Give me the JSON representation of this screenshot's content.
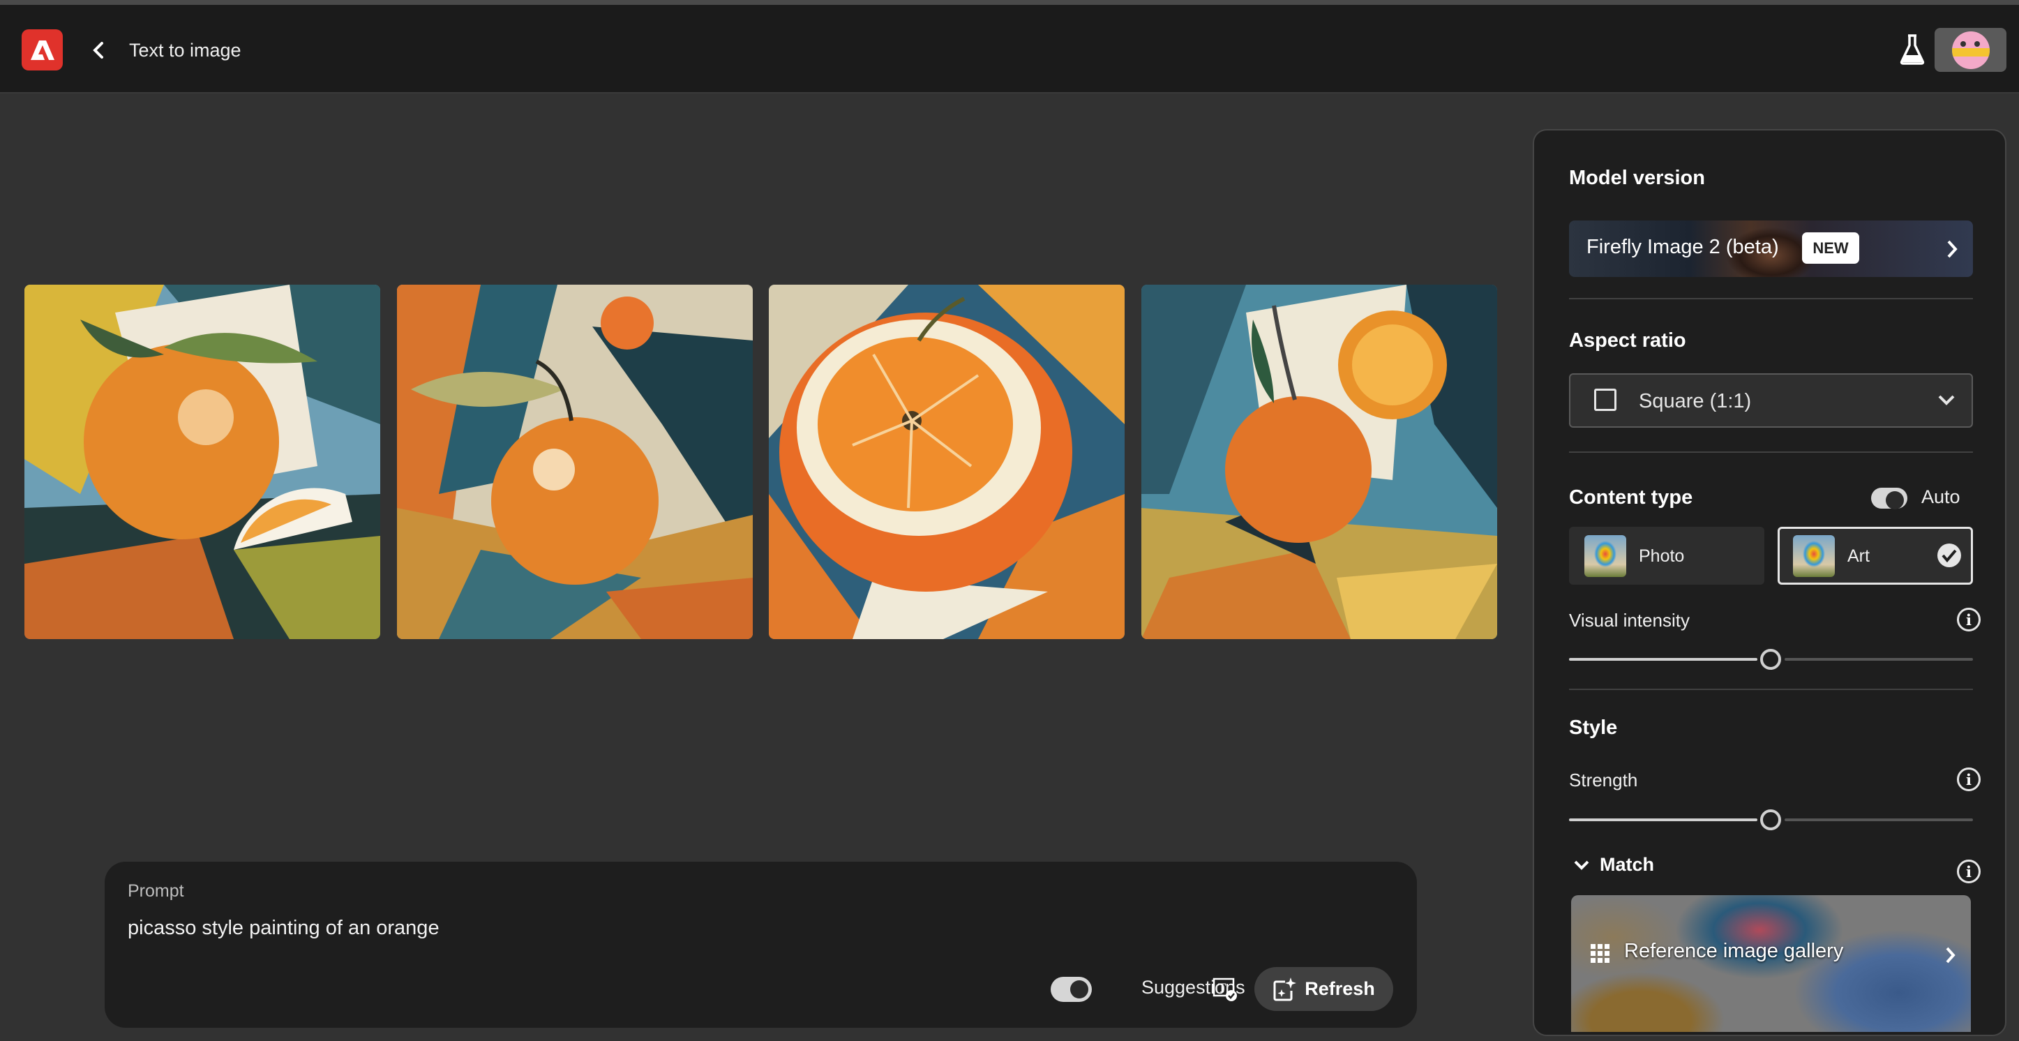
{
  "header": {
    "title": "Text to image",
    "logo": "adobe-logo",
    "back_icon": "chevron-left-icon",
    "labs_icon": "flask-icon",
    "avatar": "user-avatar"
  },
  "images": [
    {
      "alt": "orange-painting-1"
    },
    {
      "alt": "orange-painting-2"
    },
    {
      "alt": "orange-painting-3"
    },
    {
      "alt": "orange-painting-4"
    }
  ],
  "prompt": {
    "label": "Prompt",
    "value": "picasso style painting of an orange",
    "suggestions_label": "Suggestions",
    "suggestions_on": true,
    "refresh_label": "Refresh"
  },
  "panel": {
    "model_version": {
      "heading": "Model version",
      "value": "Firefly Image 2 (beta)",
      "badge": "NEW"
    },
    "aspect_ratio": {
      "heading": "Aspect ratio",
      "value": "Square (1:1)"
    },
    "content_type": {
      "heading": "Content type",
      "auto_label": "Auto",
      "auto_on": true,
      "options": [
        {
          "label": "Photo",
          "selected": false
        },
        {
          "label": "Art",
          "selected": true
        }
      ]
    },
    "visual_intensity": {
      "label": "Visual intensity",
      "value_fraction": 0.55
    },
    "style": {
      "heading": "Style",
      "strength_label": "Strength",
      "strength_fraction": 0.55,
      "match_label": "Match",
      "gallery_label": "Reference image gallery"
    }
  },
  "colors": {
    "brand": "#e0322b",
    "background": "#323232",
    "panel": "#1e1e1e"
  }
}
